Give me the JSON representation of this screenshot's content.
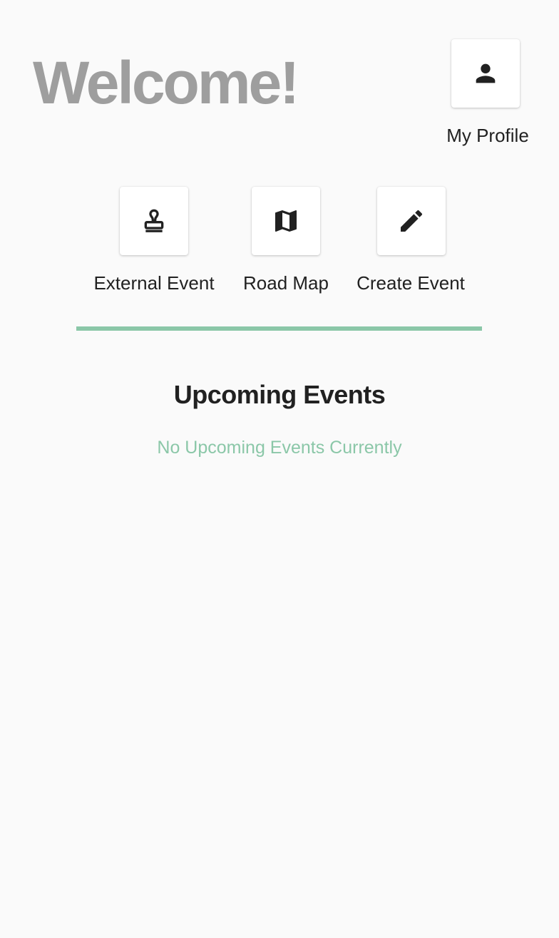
{
  "header": {
    "welcome_text": "Welcome!"
  },
  "profile": {
    "label": "My Profile",
    "icon": "person-icon"
  },
  "actions": [
    {
      "label": "External Event",
      "icon": "stamp-icon"
    },
    {
      "label": "Road Map",
      "icon": "map-icon"
    },
    {
      "label": "Create Event",
      "icon": "pencil-icon"
    }
  ],
  "upcoming": {
    "title": "Upcoming Events",
    "empty_message": "No Upcoming Events Currently"
  },
  "colors": {
    "accent": "#8bc7a8",
    "welcome_text": "#9e9e9e",
    "background": "#fafafa"
  }
}
